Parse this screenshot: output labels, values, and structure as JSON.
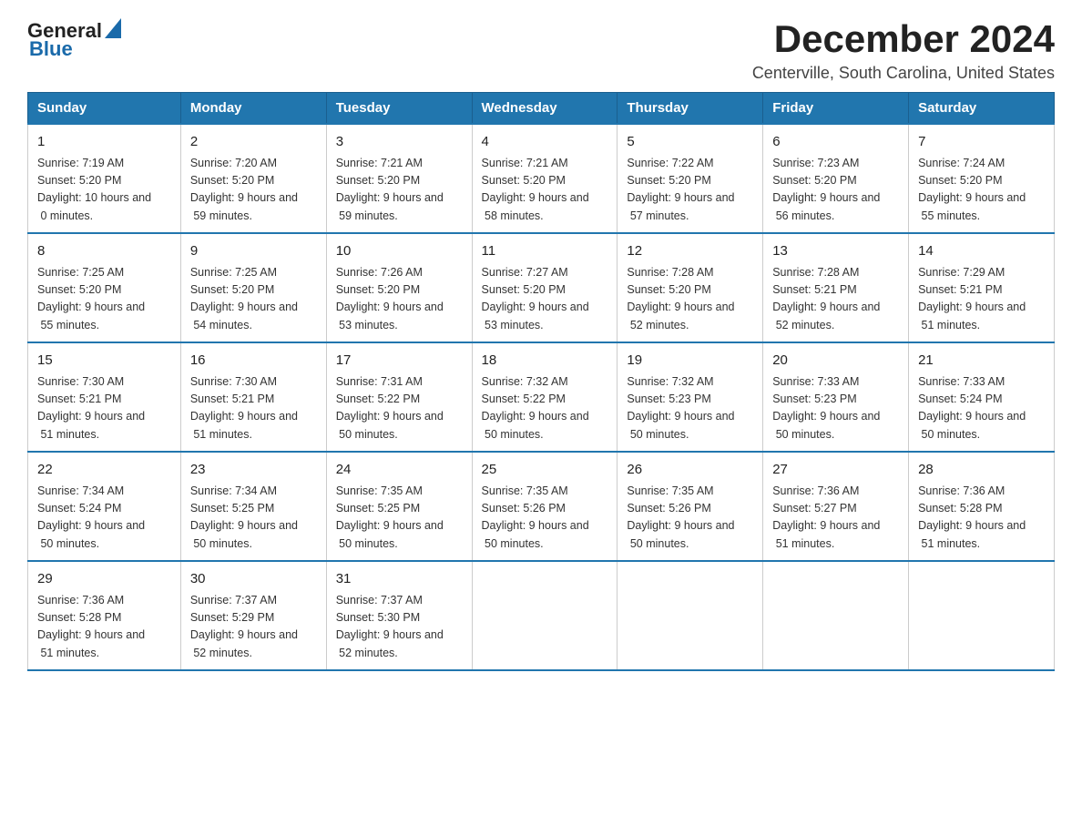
{
  "logo": {
    "text_general": "General",
    "text_blue": "Blue"
  },
  "title": "December 2024",
  "subtitle": "Centerville, South Carolina, United States",
  "days_of_week": [
    "Sunday",
    "Monday",
    "Tuesday",
    "Wednesday",
    "Thursday",
    "Friday",
    "Saturday"
  ],
  "weeks": [
    [
      {
        "day": "1",
        "sunrise": "7:19 AM",
        "sunset": "5:20 PM",
        "daylight": "10 hours and 0 minutes."
      },
      {
        "day": "2",
        "sunrise": "7:20 AM",
        "sunset": "5:20 PM",
        "daylight": "9 hours and 59 minutes."
      },
      {
        "day": "3",
        "sunrise": "7:21 AM",
        "sunset": "5:20 PM",
        "daylight": "9 hours and 59 minutes."
      },
      {
        "day": "4",
        "sunrise": "7:21 AM",
        "sunset": "5:20 PM",
        "daylight": "9 hours and 58 minutes."
      },
      {
        "day": "5",
        "sunrise": "7:22 AM",
        "sunset": "5:20 PM",
        "daylight": "9 hours and 57 minutes."
      },
      {
        "day": "6",
        "sunrise": "7:23 AM",
        "sunset": "5:20 PM",
        "daylight": "9 hours and 56 minutes."
      },
      {
        "day": "7",
        "sunrise": "7:24 AM",
        "sunset": "5:20 PM",
        "daylight": "9 hours and 55 minutes."
      }
    ],
    [
      {
        "day": "8",
        "sunrise": "7:25 AM",
        "sunset": "5:20 PM",
        "daylight": "9 hours and 55 minutes."
      },
      {
        "day": "9",
        "sunrise": "7:25 AM",
        "sunset": "5:20 PM",
        "daylight": "9 hours and 54 minutes."
      },
      {
        "day": "10",
        "sunrise": "7:26 AM",
        "sunset": "5:20 PM",
        "daylight": "9 hours and 53 minutes."
      },
      {
        "day": "11",
        "sunrise": "7:27 AM",
        "sunset": "5:20 PM",
        "daylight": "9 hours and 53 minutes."
      },
      {
        "day": "12",
        "sunrise": "7:28 AM",
        "sunset": "5:20 PM",
        "daylight": "9 hours and 52 minutes."
      },
      {
        "day": "13",
        "sunrise": "7:28 AM",
        "sunset": "5:21 PM",
        "daylight": "9 hours and 52 minutes."
      },
      {
        "day": "14",
        "sunrise": "7:29 AM",
        "sunset": "5:21 PM",
        "daylight": "9 hours and 51 minutes."
      }
    ],
    [
      {
        "day": "15",
        "sunrise": "7:30 AM",
        "sunset": "5:21 PM",
        "daylight": "9 hours and 51 minutes."
      },
      {
        "day": "16",
        "sunrise": "7:30 AM",
        "sunset": "5:21 PM",
        "daylight": "9 hours and 51 minutes."
      },
      {
        "day": "17",
        "sunrise": "7:31 AM",
        "sunset": "5:22 PM",
        "daylight": "9 hours and 50 minutes."
      },
      {
        "day": "18",
        "sunrise": "7:32 AM",
        "sunset": "5:22 PM",
        "daylight": "9 hours and 50 minutes."
      },
      {
        "day": "19",
        "sunrise": "7:32 AM",
        "sunset": "5:23 PM",
        "daylight": "9 hours and 50 minutes."
      },
      {
        "day": "20",
        "sunrise": "7:33 AM",
        "sunset": "5:23 PM",
        "daylight": "9 hours and 50 minutes."
      },
      {
        "day": "21",
        "sunrise": "7:33 AM",
        "sunset": "5:24 PM",
        "daylight": "9 hours and 50 minutes."
      }
    ],
    [
      {
        "day": "22",
        "sunrise": "7:34 AM",
        "sunset": "5:24 PM",
        "daylight": "9 hours and 50 minutes."
      },
      {
        "day": "23",
        "sunrise": "7:34 AM",
        "sunset": "5:25 PM",
        "daylight": "9 hours and 50 minutes."
      },
      {
        "day": "24",
        "sunrise": "7:35 AM",
        "sunset": "5:25 PM",
        "daylight": "9 hours and 50 minutes."
      },
      {
        "day": "25",
        "sunrise": "7:35 AM",
        "sunset": "5:26 PM",
        "daylight": "9 hours and 50 minutes."
      },
      {
        "day": "26",
        "sunrise": "7:35 AM",
        "sunset": "5:26 PM",
        "daylight": "9 hours and 50 minutes."
      },
      {
        "day": "27",
        "sunrise": "7:36 AM",
        "sunset": "5:27 PM",
        "daylight": "9 hours and 51 minutes."
      },
      {
        "day": "28",
        "sunrise": "7:36 AM",
        "sunset": "5:28 PM",
        "daylight": "9 hours and 51 minutes."
      }
    ],
    [
      {
        "day": "29",
        "sunrise": "7:36 AM",
        "sunset": "5:28 PM",
        "daylight": "9 hours and 51 minutes."
      },
      {
        "day": "30",
        "sunrise": "7:37 AM",
        "sunset": "5:29 PM",
        "daylight": "9 hours and 52 minutes."
      },
      {
        "day": "31",
        "sunrise": "7:37 AM",
        "sunset": "5:30 PM",
        "daylight": "9 hours and 52 minutes."
      },
      null,
      null,
      null,
      null
    ]
  ],
  "labels": {
    "sunrise": "Sunrise:",
    "sunset": "Sunset:",
    "daylight": "Daylight:"
  }
}
